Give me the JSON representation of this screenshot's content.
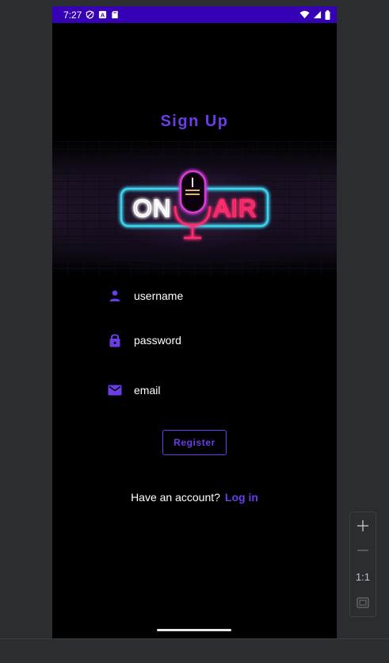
{
  "status_bar": {
    "time": "7:27",
    "left_icons": [
      "vpn-shield-icon",
      "a-letter-icon",
      "sd-card-icon"
    ],
    "right_icons": [
      "wifi-icon",
      "signal-icon",
      "battery-icon"
    ],
    "color": "#3600b5"
  },
  "page": {
    "title": "Sign Up",
    "banner": {
      "left_text": "ON",
      "right_text": "AIR",
      "icon": "microphone-icon"
    }
  },
  "form": {
    "username": {
      "icon": "person-icon",
      "value": "username"
    },
    "password": {
      "icon": "lock-icon",
      "value": "password"
    },
    "email": {
      "icon": "mail-icon",
      "value": "email"
    },
    "register_label": "Register"
  },
  "footer": {
    "prompt": "Have an account?",
    "link": "Log in"
  },
  "emulator": {
    "zoom_in": "+",
    "zoom_out": "—",
    "actual_size": "1:1",
    "fit_icon": "fit-screen-icon"
  },
  "colors": {
    "accent": "#6a3de8",
    "background": "#000000",
    "neon_blue": "#3ed3f0",
    "neon_pink": "#ff2d6e",
    "neon_magenta": "#d63bd6"
  }
}
